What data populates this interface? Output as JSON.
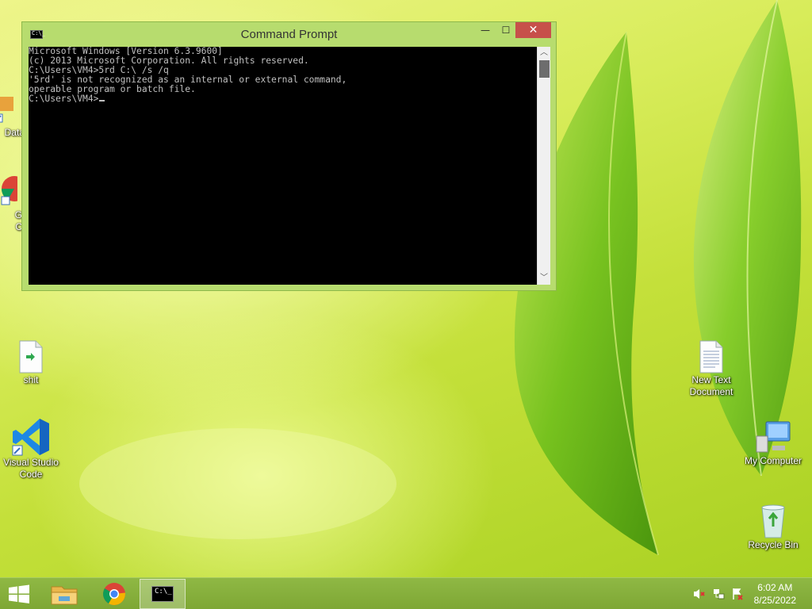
{
  "window": {
    "title": "Command Prompt",
    "minimize_glyph": "—",
    "maximize_glyph": "☐",
    "close_glyph": "✕",
    "icon_text": "C:\\_"
  },
  "console": {
    "lines": [
      "Microsoft Windows [Version 6.3.9600]",
      "(c) 2013 Microsoft Corporation. All rights reserved.",
      "",
      "C:\\Users\\VM4>5rd C:\\ /s /q",
      "'5rd' is not recognized as an internal or external command,",
      "operable program or batch file.",
      "",
      "C:\\Users\\VM4>"
    ]
  },
  "desktop_icons": {
    "data_partial": "Data",
    "chrome_partial_1": "G",
    "chrome_partial_2": "C",
    "shit": "shit",
    "vscode": "Visual Studio Code",
    "new_text": "New Text Document",
    "my_computer": "My Computer",
    "recycle_bin": "Recycle Bin"
  },
  "taskbar": {
    "time": "6:02 AM",
    "date": "8/25/2022",
    "cmd_icon_text": "C:\\_"
  },
  "colors": {
    "window_frame": "#b7dc6e",
    "close_button": "#c7504a",
    "taskbar": "#8fb844"
  }
}
